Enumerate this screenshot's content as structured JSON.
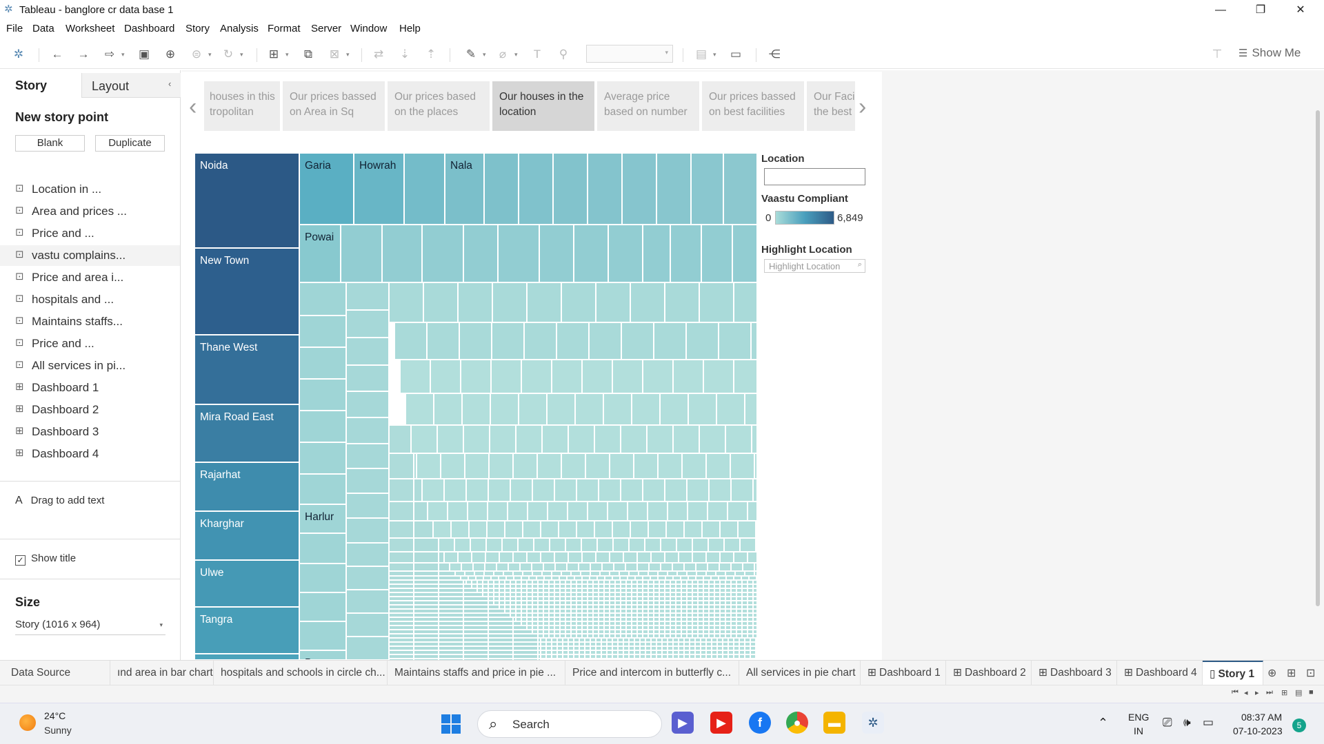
{
  "window": {
    "title": "Tableau - banglore cr data base 1",
    "minimize": "—",
    "restore": "❐",
    "close": "✕"
  },
  "menu": [
    "File",
    "Data",
    "Worksheet",
    "Dashboard",
    "Story",
    "Analysis",
    "Format",
    "Server",
    "Window",
    "Help"
  ],
  "toolbar": {
    "show_me": "Show Me"
  },
  "left_panel": {
    "tab_story": "Story",
    "tab_layout": "Layout",
    "new_story_point": "New story point",
    "blank_button": "Blank",
    "duplicate_button": "Duplicate",
    "sheets": [
      {
        "label": "Location in ...",
        "icon": "worksheet-icon"
      },
      {
        "label": "Area and prices ...",
        "icon": "worksheet-icon"
      },
      {
        "label": "Price and ...",
        "icon": "worksheet-icon"
      },
      {
        "label": "vastu complains...",
        "icon": "worksheet-icon"
      },
      {
        "label": "Price and area i...",
        "icon": "worksheet-icon"
      },
      {
        "label": "hospitals and ...",
        "icon": "worksheet-icon"
      },
      {
        "label": "Maintains staffs...",
        "icon": "worksheet-icon"
      },
      {
        "label": "Price and ...",
        "icon": "worksheet-icon"
      },
      {
        "label": "All services in pi...",
        "icon": "worksheet-icon"
      },
      {
        "label": "Dashboard 1",
        "icon": "dashboard-icon"
      },
      {
        "label": "Dashboard 2",
        "icon": "dashboard-icon"
      },
      {
        "label": "Dashboard 3",
        "icon": "dashboard-icon"
      },
      {
        "label": "Dashboard 4",
        "icon": "dashboard-icon"
      }
    ],
    "drag_text": "Drag to add text",
    "show_title": "Show title",
    "show_title_checked": true,
    "size_title": "Size",
    "size_value": "Story (1016 x 964)"
  },
  "story_points": [
    {
      "text": "houses in this tropolitan",
      "active": false
    },
    {
      "text": "Our prices bassed on Area in Sq",
      "active": false
    },
    {
      "text": "Our prices based on the places",
      "active": false
    },
    {
      "text": "Our houses in the location",
      "active": true
    },
    {
      "text": "Average price based on number",
      "active": false
    },
    {
      "text": "Our prices bassed on best facilities",
      "active": false
    },
    {
      "text": "Our Faci the best",
      "active": false
    }
  ],
  "treemap_labels": {
    "big": [
      "Noida",
      "New Town",
      "Thane West",
      "Mira Road East",
      "Rajarhat",
      "Kharghar",
      "Ulwe",
      "Tangra"
    ],
    "top_row": [
      "Garia",
      "Howrah",
      "",
      "Nala"
    ],
    "powai": "Powai",
    "harlur": "Harlur",
    "begur": "Begur"
  },
  "legend": {
    "location_title": "Location",
    "vaastu_title": "Vaastu Compliant",
    "vaastu_min": "0",
    "vaastu_max": "6,849",
    "highlight_title": "Highlight Location",
    "highlight_placeholder": "Highlight Location",
    "colors": {
      "low": "#a9dcd9",
      "mid": "#4a9fbd",
      "high": "#2e5b87"
    }
  },
  "sheet_tabs": [
    {
      "label": "Data Source",
      "icon": "database-icon"
    },
    {
      "label": "ınd area in bar chart"
    },
    {
      "label": "hospitals and schools in circle ch..."
    },
    {
      "label": "Maintains staffs and price in pie ..."
    },
    {
      "label": "Price and intercom in butterfly c..."
    },
    {
      "label": "All services in pie chart"
    },
    {
      "label": "Dashboard 1",
      "icon": "dashboard-icon"
    },
    {
      "label": "Dashboard 2",
      "icon": "dashboard-icon"
    },
    {
      "label": "Dashboard 3",
      "icon": "dashboard-icon"
    },
    {
      "label": "Dashboard 4",
      "icon": "dashboard-icon"
    },
    {
      "label": "Story 1",
      "icon": "story-icon",
      "active": true
    }
  ],
  "taskbar": {
    "temperature": "24°C",
    "condition": "Sunny",
    "search": "Search",
    "lang1": "ENG",
    "lang2": "IN",
    "time": "08:37 AM",
    "date": "07-10-2023",
    "notifications": "5"
  }
}
